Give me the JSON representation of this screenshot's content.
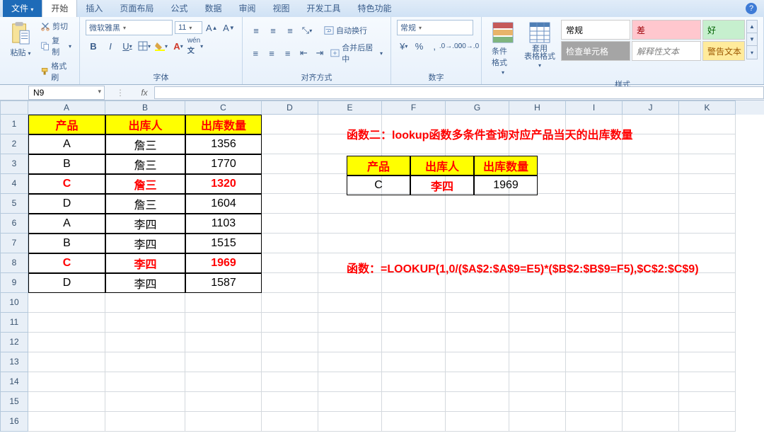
{
  "tabs": {
    "file": "文件",
    "list": [
      "开始",
      "插入",
      "页面布局",
      "公式",
      "数据",
      "审阅",
      "视图",
      "开发工具",
      "特色功能"
    ]
  },
  "clipboard": {
    "paste": "粘贴",
    "cut": "剪切",
    "copy": "复制",
    "format_painter": "格式刷",
    "label": "剪贴板"
  },
  "font": {
    "family": "微软雅黑",
    "size": "11",
    "label": "字体"
  },
  "align": {
    "wrap": "自动换行",
    "merge": "合并后居中",
    "label": "对齐方式"
  },
  "number": {
    "format": "常规",
    "label": "数字"
  },
  "styles": {
    "cond": "条件格式",
    "table": "套用\n表格格式",
    "normal": "常规",
    "bad": "差",
    "good": "好",
    "check": "检查单元格",
    "explain": "解释性文本",
    "warn": "警告文本",
    "label": "样式"
  },
  "namebox": "N9",
  "fx": "fx",
  "columns": [
    "A",
    "B",
    "C",
    "D",
    "E",
    "F",
    "G",
    "H",
    "I",
    "J",
    "K"
  ],
  "rownums": [
    "1",
    "2",
    "3",
    "4",
    "5",
    "6",
    "7",
    "8",
    "9",
    "10",
    "11",
    "12",
    "13",
    "14",
    "15",
    "16"
  ],
  "main_table": {
    "headers": [
      "产品",
      "出库人",
      "出库数量"
    ],
    "rows": [
      {
        "p": "A",
        "n": "詹三",
        "q": "1356",
        "hl": false
      },
      {
        "p": "B",
        "n": "詹三",
        "q": "1770",
        "hl": false
      },
      {
        "p": "C",
        "n": "詹三",
        "q": "1320",
        "hl": true
      },
      {
        "p": "D",
        "n": "詹三",
        "q": "1604",
        "hl": false
      },
      {
        "p": "A",
        "n": "李四",
        "q": "1103",
        "hl": false
      },
      {
        "p": "B",
        "n": "李四",
        "q": "1515",
        "hl": false
      },
      {
        "p": "C",
        "n": "李四",
        "q": "1969",
        "hl": true
      },
      {
        "p": "D",
        "n": "李四",
        "q": "1587",
        "hl": false
      }
    ]
  },
  "note1": "函数二：lookup函数多条件查询对应产品当天的出库数量",
  "mini_table": {
    "headers": [
      "产品",
      "出库人",
      "出库数量"
    ],
    "row": {
      "p": "C",
      "n": "李四",
      "q": "1969"
    }
  },
  "note2": "函数：=LOOKUP(1,0/($A$2:$A$9=E5)*($B$2:$B$9=F5),$C$2:$C$9)"
}
